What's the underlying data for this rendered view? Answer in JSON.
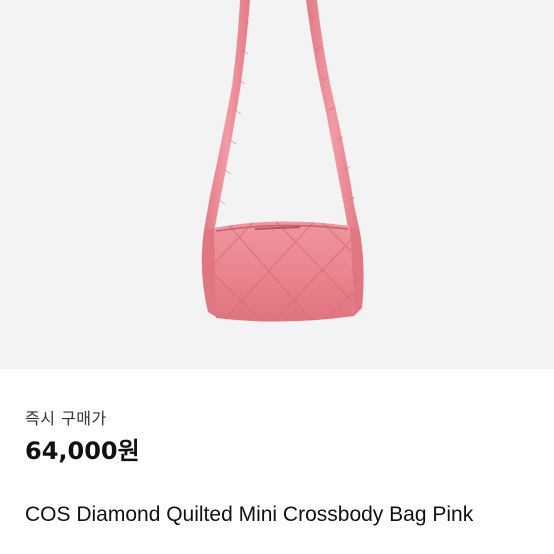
{
  "product": {
    "image_icon": "pink-quilted-crossbody-bag",
    "price_type_label": "즉시 구매가",
    "price": "64,000원",
    "title": "COS Diamond Quilted Mini Crossbody Bag Pink"
  },
  "colors": {
    "image_background": "#f3f3f3",
    "bag_pink": "#ec8690",
    "text_primary": "#111111",
    "text_secondary": "#333333"
  }
}
